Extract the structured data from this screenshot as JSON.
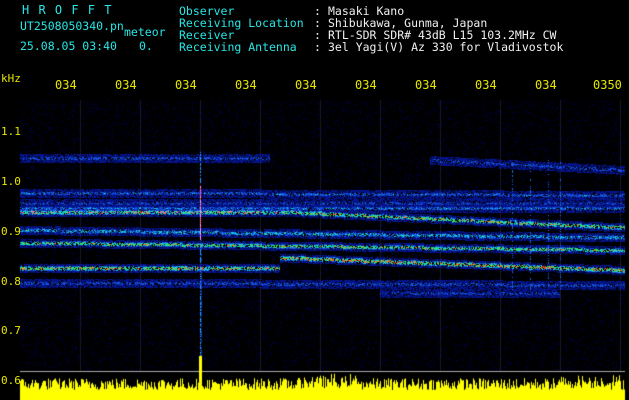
{
  "header": {
    "brand": "H R O F F T",
    "filename": "UT2508050340.pn",
    "mode": "meteor",
    "datetime": "25.08.05 03:40",
    "counter": "0.",
    "fields": [
      {
        "label": "Observer",
        "value": "Masaki Kano"
      },
      {
        "label": "Receiving Location",
        "value": "Shibukawa, Gunma, Japan"
      },
      {
        "label": "Receiver",
        "value": "RTL-SDR SDR# 43dB L15 103.2MHz CW"
      },
      {
        "label": "Receiving Antenna",
        "value": "3el Yagi(V) Az 330 for Vladivostok"
      }
    ],
    "separator": ":"
  },
  "axes": {
    "unit": "kHz",
    "y_ticks": [
      "1.1",
      "1.0",
      "0.9",
      "0.8",
      "0.7",
      "0.6"
    ],
    "x_ticks": [
      "034",
      "034",
      "034",
      "034",
      "034",
      "034",
      "034",
      "034",
      "034",
      "0350"
    ]
  },
  "colors": {
    "background": "#000000",
    "header_label": "#28e6e6",
    "header_value": "#f0f0f0",
    "axis_text": "#e6e600",
    "signal_band": "#1030c0",
    "signal_peak": "#ff2020",
    "amplitude_trace": "#ffff00"
  }
}
